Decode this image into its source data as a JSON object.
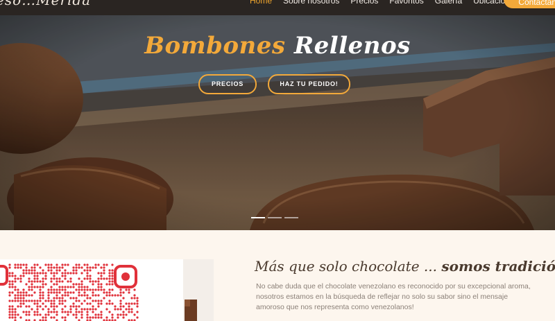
{
  "brand": {
    "text": "eso…Mérida"
  },
  "nav": {
    "items": [
      {
        "label": "Home",
        "active": true
      },
      {
        "label": "Sobre nosotros",
        "active": false
      },
      {
        "label": "Precios",
        "active": false
      },
      {
        "label": "Favoritos",
        "active": false
      },
      {
        "label": "Galería",
        "active": false
      },
      {
        "label": "Ubicación",
        "active": false
      }
    ],
    "contact_label": "Contáctanos"
  },
  "hero": {
    "title_part1": "Bombones",
    "title_part2": "Rellenos",
    "buttons": {
      "prices": "PRECIOS",
      "order": "HAZ TU PEDIDO!"
    },
    "slides_total": 3,
    "slide_active": 1
  },
  "about": {
    "title_regular": "Más que solo chocolate ...",
    "title_bold": "somos tradición",
    "body_lines": [
      "No cabe duda que el chocolate venezolano es reconocido por su excepcional aroma,",
      "nosotros estamos en la búsqueda de reflejar no solo su sabor sino el mensaje",
      "amoroso que nos representa como venezolanos!"
    ]
  },
  "colors": {
    "accent": "#f3a93a",
    "dark": "#2a2522",
    "cream": "#fdf6ee",
    "chocolate": "#5a3a26"
  }
}
